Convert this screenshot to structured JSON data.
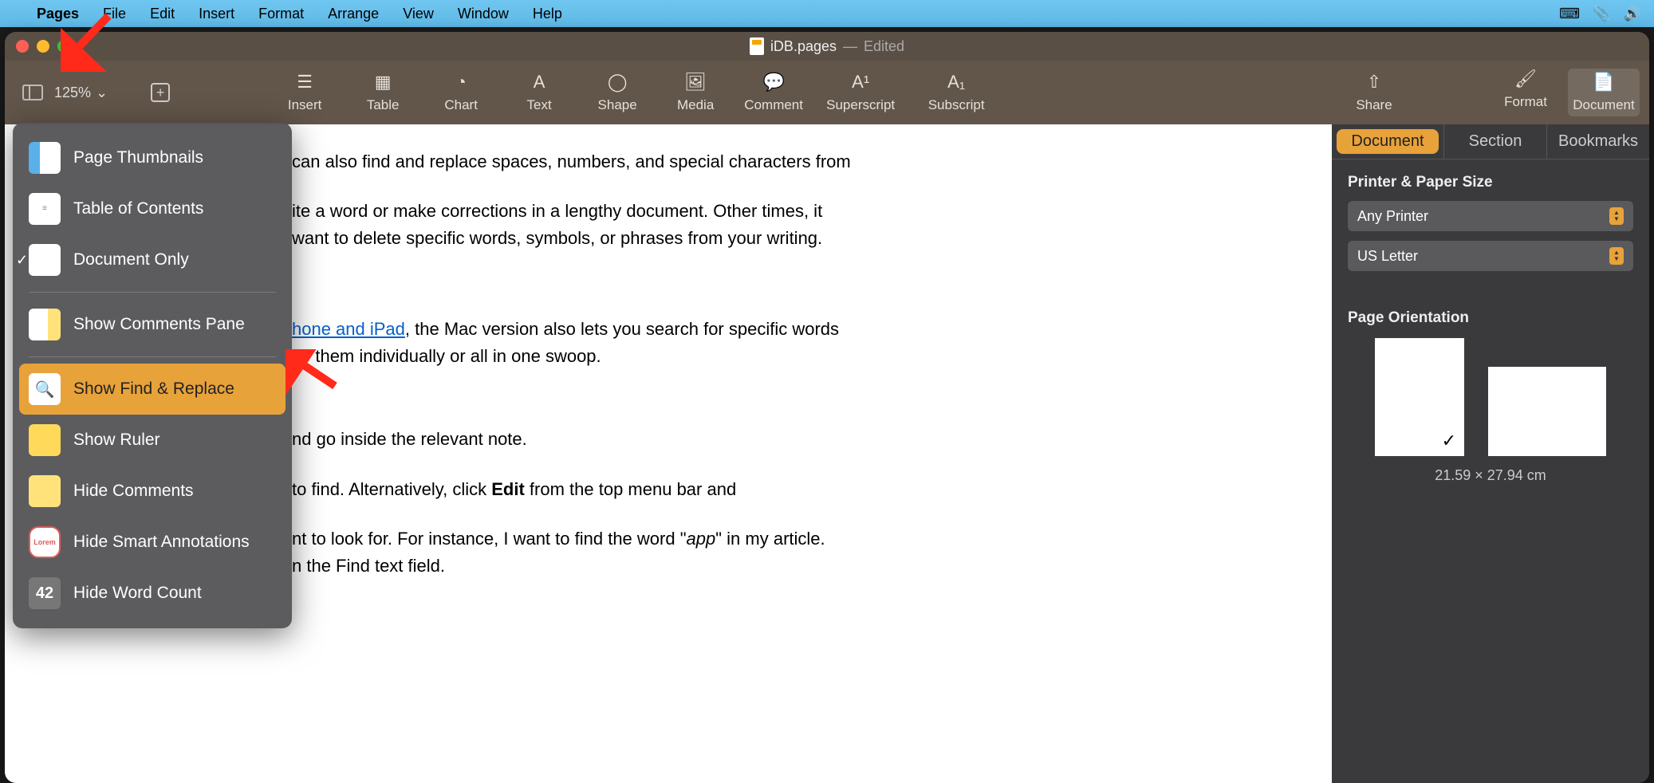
{
  "menubar": {
    "app": "Pages",
    "items": [
      "File",
      "Edit",
      "Insert",
      "Format",
      "Arrange",
      "View",
      "Window",
      "Help"
    ]
  },
  "window": {
    "title": "iDB.pages",
    "status": "Edited"
  },
  "toolbar": {
    "zoom": "125%",
    "items": [
      {
        "label": "Insert"
      },
      {
        "label": "Table"
      },
      {
        "label": "Chart"
      },
      {
        "label": "Text"
      },
      {
        "label": "Shape"
      },
      {
        "label": "Media"
      },
      {
        "label": "Comment"
      },
      {
        "label": "Superscript"
      },
      {
        "label": "Subscript"
      }
    ],
    "right": [
      {
        "label": "Share"
      },
      {
        "label": "Format"
      },
      {
        "label": "Document"
      }
    ]
  },
  "view_menu": {
    "items": [
      {
        "label": "Page Thumbnails",
        "icon": "thumb"
      },
      {
        "label": "Table of Contents",
        "icon": "toc"
      },
      {
        "label": "Document Only",
        "icon": "doconly",
        "selected": true
      },
      {
        "sep": true
      },
      {
        "label": "Show Comments Pane",
        "icon": "comments"
      },
      {
        "sep": true
      },
      {
        "label": "Show Find & Replace",
        "icon": "find",
        "highlighted": true
      },
      {
        "label": "Show Ruler",
        "icon": "ruler"
      },
      {
        "label": "Hide Comments",
        "icon": "hidecomments"
      },
      {
        "label": "Hide Smart Annotations",
        "icon": "lorem"
      },
      {
        "label": "Hide Word Count",
        "icon": "wc",
        "iconText": "42"
      }
    ]
  },
  "document": {
    "p1": " can also find and replace spaces, numbers, and special characters from",
    "p2a": "ite a word or make corrections in a lengthy document. Other times, it",
    "p2b": " want to delete specific words, symbols, or phrases from your writing.",
    "p3link": "hone and iPad",
    "p3a": ", the Mac version also lets you search for specific words",
    "p3b": "ce them individually or all in one swoop.",
    "p4": "nd go inside the relevant note.",
    "p5a": " to find. Alternatively, click ",
    "p5bold": "Edit",
    "p5b": " from the top menu bar and",
    "p6a": "nt to look for. For instance, I want to find the word \"",
    "p6ital": "app",
    "p6b": "\" in my article.",
    "p6c": "n the Find text field."
  },
  "inspector": {
    "tabs": [
      "Document",
      "Section",
      "Bookmarks"
    ],
    "printer_section": "Printer & Paper Size",
    "printer": "Any Printer",
    "paper": "US Letter",
    "orientation_label": "Page Orientation",
    "dimensions": "21.59 × 27.94 cm"
  }
}
